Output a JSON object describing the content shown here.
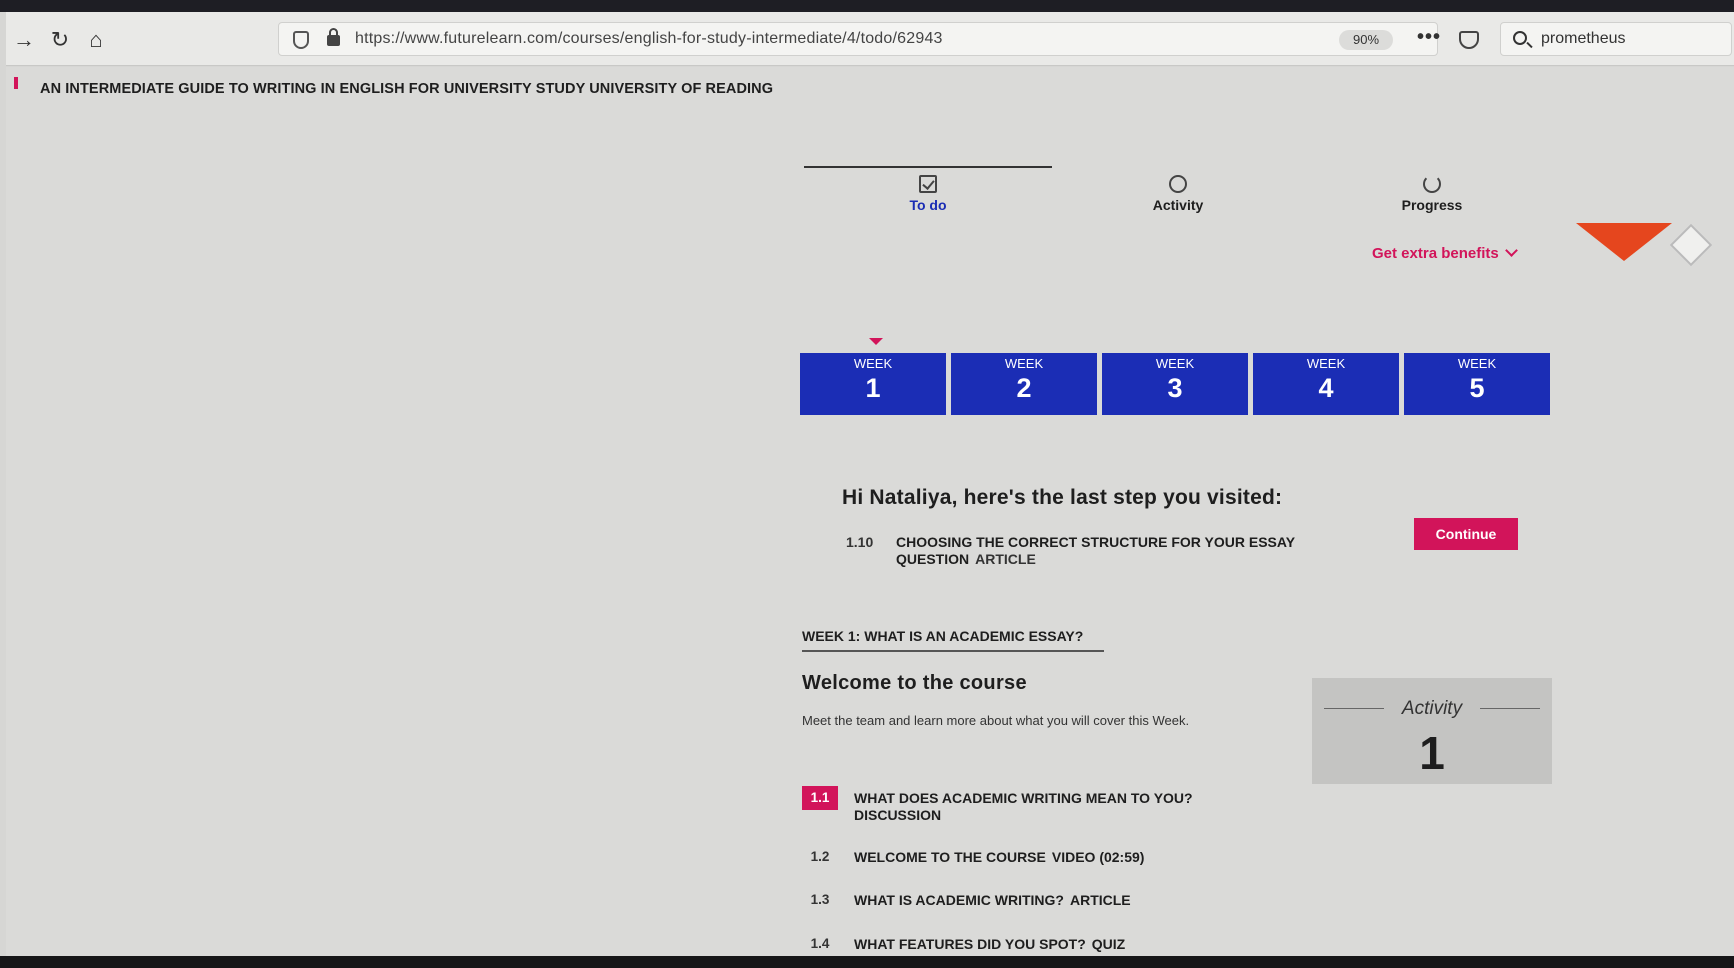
{
  "browser": {
    "url": "https://www.futurelearn.com/courses/english-for-study-intermediate/4/todo/62943",
    "zoom": "90%",
    "search_value": "prometheus"
  },
  "course": {
    "title": "AN INTERMEDIATE GUIDE TO WRITING IN ENGLISH FOR UNIVERSITY STUDY UNIVERSITY OF READING"
  },
  "tabs": [
    {
      "label": "To do",
      "active": true
    },
    {
      "label": "Activity",
      "active": false
    },
    {
      "label": "Progress",
      "active": false
    }
  ],
  "benefits_label": "Get extra benefits",
  "weeks": [
    {
      "label": "WEEK",
      "number": "1"
    },
    {
      "label": "WEEK",
      "number": "2"
    },
    {
      "label": "WEEK",
      "number": "3"
    },
    {
      "label": "WEEK",
      "number": "4"
    },
    {
      "label": "WEEK",
      "number": "5"
    }
  ],
  "last_step": {
    "greeting": "Hi Nataliya, here's the last step you visited:",
    "number": "1.10",
    "title": "CHOOSING THE CORRECT STRUCTURE FOR YOUR ESSAY QUESTION",
    "type": "ARTICLE",
    "continue_label": "Continue"
  },
  "week_section": {
    "heading": "WEEK 1: WHAT IS AN ACADEMIC ESSAY?",
    "title": "Welcome to the course",
    "description": "Meet the team and learn more about what you will cover this Week.",
    "activity_label": "Activity",
    "activity_number": "1"
  },
  "steps": [
    {
      "number": "1.1",
      "title": "WHAT DOES ACADEMIC WRITING MEAN TO YOU?",
      "type": "DISCUSSION",
      "active": true
    },
    {
      "number": "1.2",
      "title": "WELCOME TO THE COURSE",
      "type": "VIDEO (02:59)",
      "active": false
    },
    {
      "number": "1.3",
      "title": "WHAT IS ACADEMIC WRITING?",
      "type": "ARTICLE",
      "active": false
    },
    {
      "number": "1.4",
      "title": "WHAT FEATURES DID YOU SPOT?",
      "type": "QUIZ",
      "active": false
    }
  ],
  "colors": {
    "brand_pink": "#d2145a",
    "week_blue": "#1b2db5",
    "active_tab": "#1a2cb4"
  }
}
